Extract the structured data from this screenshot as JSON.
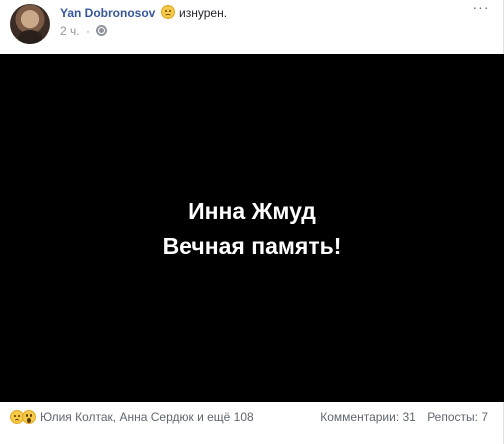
{
  "post": {
    "author": "Yan Dobronosov",
    "feeling_text": "изнурен.",
    "time": "2 ч.",
    "meta_separator": "·",
    "more_glyph": "···",
    "image_line1": "Инна Жмуд",
    "image_line2": "Вечная память!",
    "reactions_text": "Юлия Колтак, Анна Сердюк и ещё 108",
    "comments": "Комментарии: 31",
    "shares": "Репосты: 7"
  },
  "colors": {
    "author_link": "#365899",
    "meta_gray": "#90949c",
    "image_bg": "#000000",
    "image_text": "#ffffff"
  },
  "icons": [
    "avatar",
    "feeling-emoji-icon",
    "globe-icon",
    "more-icon",
    "sad-reaction-icon",
    "wow-reaction-icon"
  ]
}
